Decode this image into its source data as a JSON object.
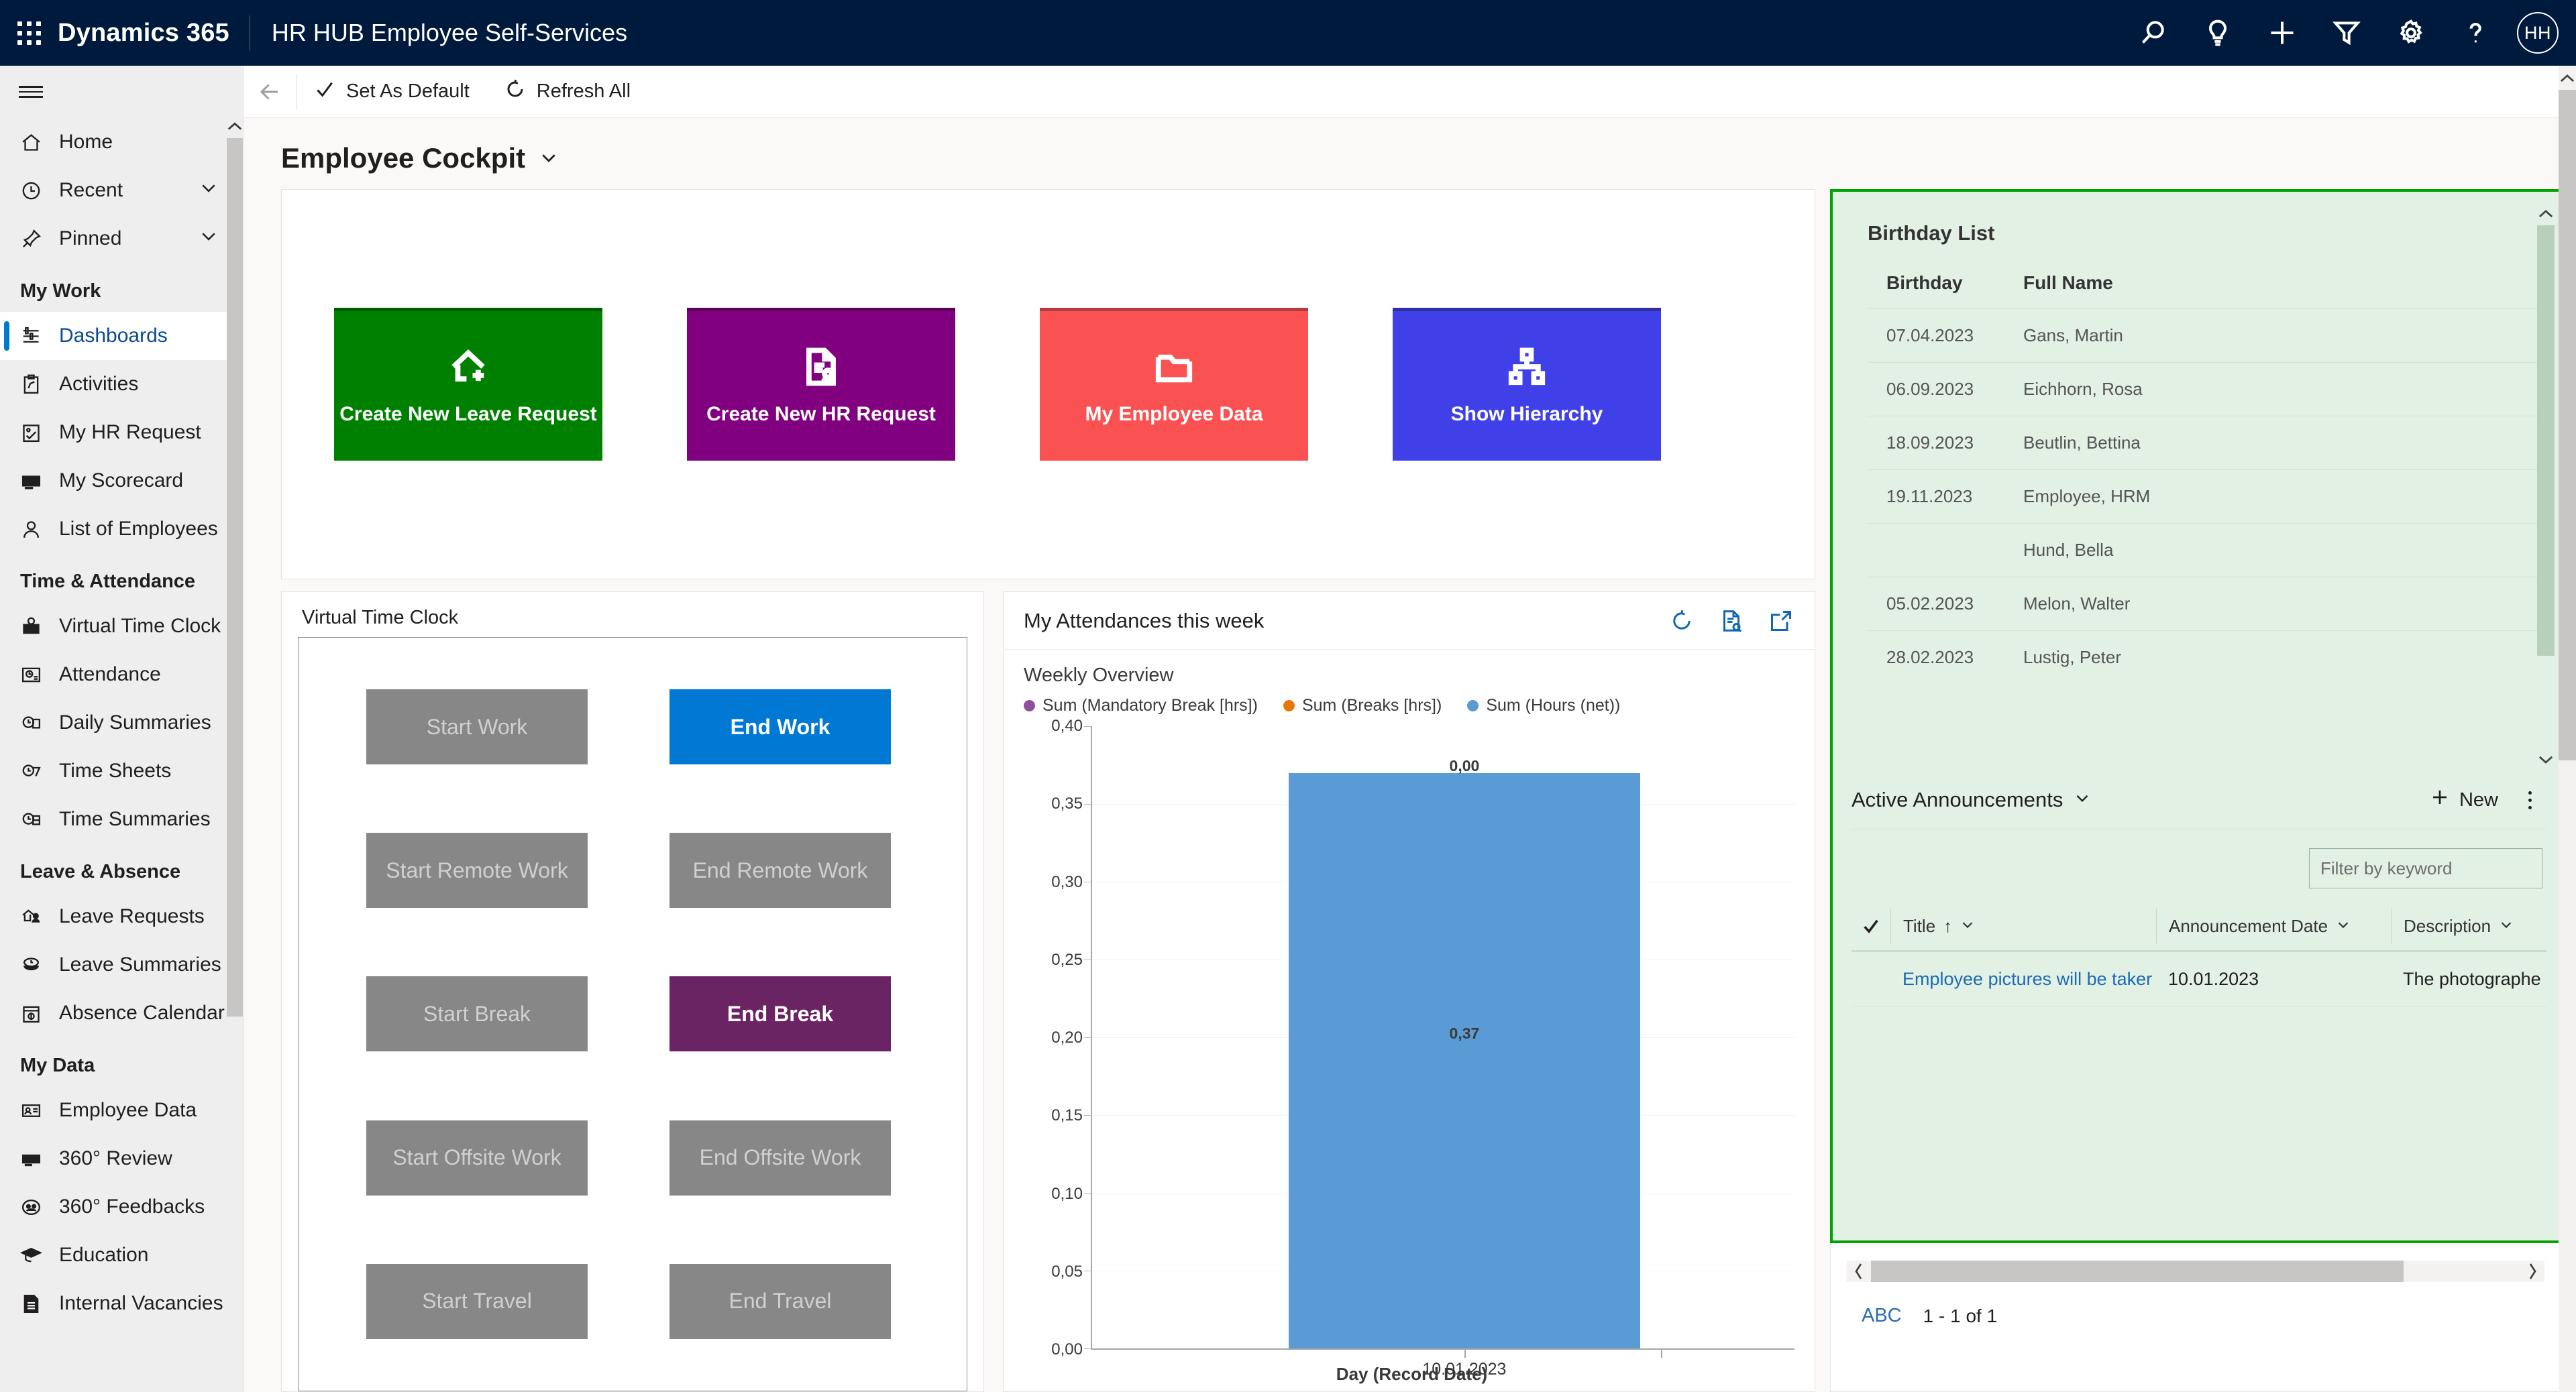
{
  "topbar": {
    "waffle_label": "app-launcher",
    "brand": "Dynamics 365",
    "app_name": "HR HUB Employee Self-Services",
    "icons": [
      "search-icon",
      "lightbulb-icon",
      "plus-icon",
      "filter-icon",
      "gear-icon",
      "help-icon"
    ],
    "avatar_initials": "HH"
  },
  "sidebar": {
    "items": [
      {
        "label": "Home",
        "icon": "home-icon",
        "type": "item"
      },
      {
        "label": "Recent",
        "icon": "clock-icon",
        "type": "expandable"
      },
      {
        "label": "Pinned",
        "icon": "pin-icon",
        "type": "expandable"
      },
      {
        "label": "My Work",
        "type": "group"
      },
      {
        "label": "Dashboards",
        "icon": "dashboard-icon",
        "type": "item",
        "selected": true
      },
      {
        "label": "Activities",
        "icon": "activities-icon",
        "type": "item"
      },
      {
        "label": "My HR Request",
        "icon": "hr-request-icon",
        "type": "item"
      },
      {
        "label": "My Scorecard",
        "icon": "scorecard-icon",
        "type": "item"
      },
      {
        "label": "List of Employees",
        "icon": "person-icon",
        "type": "item"
      },
      {
        "label": "Time & Attendance",
        "type": "group"
      },
      {
        "label": "Virtual Time Clock",
        "icon": "time-clock-icon",
        "type": "item"
      },
      {
        "label": "Attendance",
        "icon": "attendance-icon",
        "type": "item"
      },
      {
        "label": "Daily Summaries",
        "icon": "daily-summary-icon",
        "type": "item"
      },
      {
        "label": "Time Sheets",
        "icon": "timesheet-icon",
        "type": "item"
      },
      {
        "label": "Time Summaries",
        "icon": "time-summary-icon",
        "type": "item"
      },
      {
        "label": "Leave & Absence",
        "type": "group"
      },
      {
        "label": "Leave Requests",
        "icon": "leave-request-icon",
        "type": "item"
      },
      {
        "label": "Leave Summaries",
        "icon": "leave-summary-icon",
        "type": "item"
      },
      {
        "label": "Absence Calendar",
        "icon": "calendar-icon",
        "type": "item"
      },
      {
        "label": "My Data",
        "type": "group"
      },
      {
        "label": "Employee Data",
        "icon": "id-card-icon",
        "type": "item"
      },
      {
        "label": "360° Review",
        "icon": "review-icon",
        "type": "item"
      },
      {
        "label": "360° Feedbacks",
        "icon": "feedback-icon",
        "type": "item"
      },
      {
        "label": "Education",
        "icon": "graduation-icon",
        "type": "item"
      },
      {
        "label": "Internal Vacancies",
        "icon": "document-icon",
        "type": "item"
      }
    ]
  },
  "commandbar": {
    "back_icon": "back-arrow-icon",
    "set_as_default": "Set As Default",
    "set_as_default_icon": "check-icon",
    "refresh_all": "Refresh All",
    "refresh_all_icon": "refresh-icon"
  },
  "page": {
    "title": "Employee Cockpit",
    "chevron_icon": "chevron-down-icon"
  },
  "tiles": [
    {
      "label": "Create New Leave Request",
      "color": "#008000",
      "icon": "house-plus-icon"
    },
    {
      "label": "Create New HR Request",
      "color": "#800080",
      "icon": "document-person-icon"
    },
    {
      "label": "My Employee Data",
      "color": "#fa5252",
      "icon": "folder-icon"
    },
    {
      "label": "Show Hierarchy",
      "color": "#4040e8",
      "icon": "hierarchy-icon"
    }
  ],
  "virtual_time_clock": {
    "title": "Virtual Time Clock",
    "buttons": [
      {
        "label": "Start Work",
        "state": "disabled"
      },
      {
        "label": "End Work",
        "state": "primary"
      },
      {
        "label": "Start Remote Work",
        "state": "disabled"
      },
      {
        "label": "End Remote Work",
        "state": "disabled"
      },
      {
        "label": "Start Break",
        "state": "disabled"
      },
      {
        "label": "End Break",
        "state": "purple"
      },
      {
        "label": "Start Offsite Work",
        "state": "disabled"
      },
      {
        "label": "End Offsite Work",
        "state": "disabled"
      },
      {
        "label": "Start Travel",
        "state": "disabled"
      },
      {
        "label": "End Travel",
        "state": "disabled"
      }
    ]
  },
  "attendance_chart_panel": {
    "title": "My Attendances this week",
    "actions": [
      "refresh-icon",
      "view-records-icon",
      "expand-icon"
    ]
  },
  "chart_data": {
    "type": "bar",
    "title": "Weekly Overview",
    "xlabel": "Day (Record Date)",
    "ylabel": "",
    "categories": [
      "10.01.2023"
    ],
    "ylim": [
      0,
      0.4
    ],
    "yticks": [
      "0,00",
      "0,05",
      "0,10",
      "0,15",
      "0,20",
      "0,25",
      "0,30",
      "0,35",
      "0,40"
    ],
    "grid": true,
    "legend_position": "top",
    "legend": [
      {
        "name": "Sum (Mandatory Break [hrs])",
        "color": "#8e4f9e"
      },
      {
        "name": "Sum (Breaks [hrs])",
        "color": "#e8750a"
      },
      {
        "name": "Sum (Hours (net))",
        "color": "#5b9bd5"
      }
    ],
    "series": [
      {
        "name": "Sum (Mandatory Break [hrs])",
        "color": "#8e4f9e",
        "values": [
          0
        ]
      },
      {
        "name": "Sum (Breaks [hrs])",
        "color": "#e8750a",
        "values": [
          0
        ]
      },
      {
        "name": "Sum (Hours (net))",
        "color": "#5b9bd5",
        "values": [
          0.37
        ]
      }
    ],
    "data_labels": {
      "top": "0,00",
      "bar": "0,37"
    }
  },
  "birthday_list": {
    "title": "Birthday List",
    "columns": [
      "Birthday",
      "Full Name"
    ],
    "rows": [
      {
        "birthday": "07.04.2023",
        "name": "Gans, Martin"
      },
      {
        "birthday": "06.09.2023",
        "name": "Eichhorn, Rosa"
      },
      {
        "birthday": "18.09.2023",
        "name": "Beutlin, Bettina"
      },
      {
        "birthday": "19.11.2023",
        "name": "Employee, HRM"
      },
      {
        "birthday": "",
        "name": "Hund, Bella"
      },
      {
        "birthday": "05.02.2023",
        "name": "Melon, Walter"
      },
      {
        "birthday": "28.02.2023",
        "name": "Lustig, Peter"
      }
    ]
  },
  "announcements": {
    "title": "Active Announcements",
    "new_label": "New",
    "filter_placeholder": "Filter by keyword",
    "columns": [
      {
        "label": "Title",
        "sort": "↑"
      },
      {
        "label": "Announcement Date"
      },
      {
        "label": "Description"
      }
    ],
    "rows": [
      {
        "title": "Employee pictures will be taker",
        "date": "10.01.2023",
        "description": "The photographe"
      }
    ],
    "abc_label": "ABC",
    "page_count": "1 - 1 of 1"
  }
}
